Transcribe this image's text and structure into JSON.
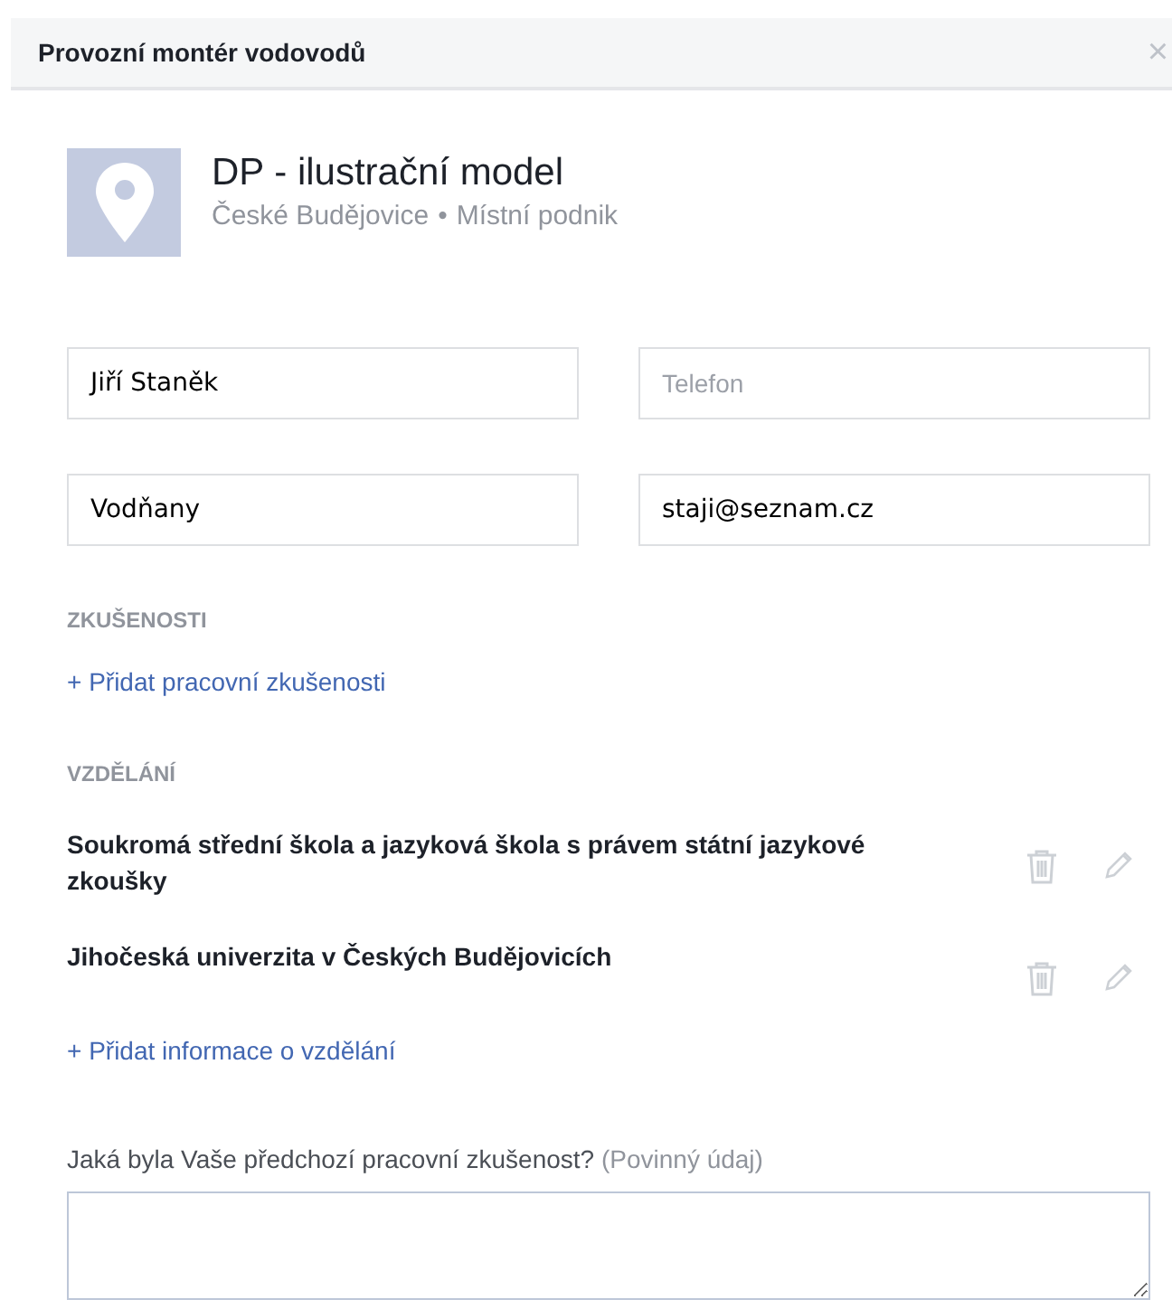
{
  "dialog": {
    "title": "Provozní montér vodovodů",
    "close": "×"
  },
  "company": {
    "name": "DP - ilustrační model",
    "city": "České Budějovice",
    "separator": "•",
    "type": "Místní podnik"
  },
  "fields": [
    {
      "value": "Jiří Staněk"
    },
    {
      "placeholder": "Telefon"
    },
    {
      "value": "Vodňany"
    },
    {
      "value": "staji@seznam.cz"
    }
  ],
  "experience": {
    "heading": "ZKUŠENOSTI",
    "add_link": "+ Přidat pracovní zkušenosti"
  },
  "education": {
    "heading": "VZDĚLÁNÍ",
    "items": [
      {
        "name": "Soukromá střední škola a jazyková škola s právem státní jazykové zkoušky"
      },
      {
        "name": "Jihočeská univerzita v Českých Budějovicích"
      }
    ],
    "add_link": "+ Přidat informace o vzdělání"
  },
  "question": {
    "label": "Jaká byla Vaše předchozí pracovní zkušenost?",
    "required": "(Povinný údaj)"
  }
}
